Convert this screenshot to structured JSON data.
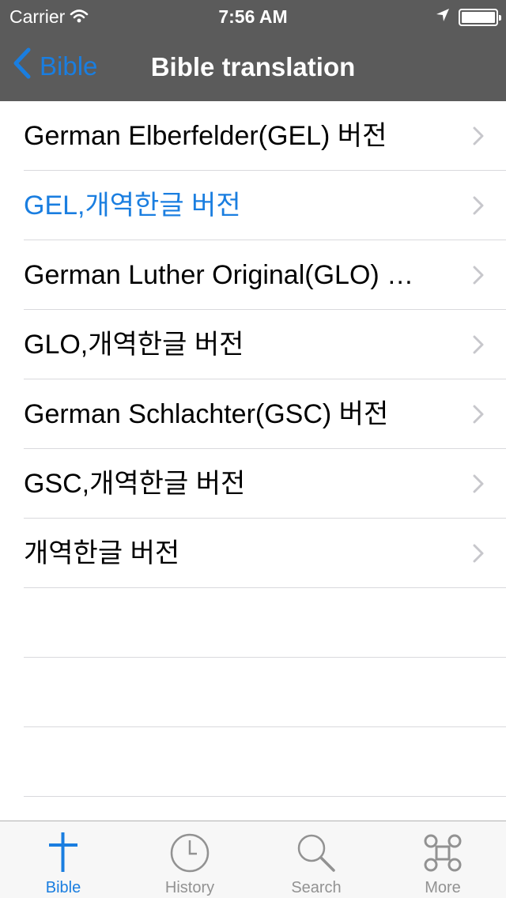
{
  "status_bar": {
    "carrier": "Carrier",
    "time": "7:56 AM"
  },
  "nav": {
    "back_label": "Bible",
    "title": "Bible translation"
  },
  "colors": {
    "accent": "#1a7ee0",
    "nav_background": "#5b5b5b"
  },
  "translations": [
    {
      "label": "German Elberfelder(GEL) 버전",
      "selected": false
    },
    {
      "label": "GEL,개역한글 버전",
      "selected": true
    },
    {
      "label": "German Luther Original(GLO) 버전",
      "selected": false
    },
    {
      "label": "GLO,개역한글 버전",
      "selected": false
    },
    {
      "label": "German Schlachter(GSC) 버전",
      "selected": false
    },
    {
      "label": "GSC,개역한글 버전",
      "selected": false
    },
    {
      "label": "개역한글 버전",
      "selected": false
    }
  ],
  "tabs": [
    {
      "label": "Bible",
      "icon": "cross-icon",
      "active": true
    },
    {
      "label": "History",
      "icon": "clock-icon",
      "active": false
    },
    {
      "label": "Search",
      "icon": "magnifier-icon",
      "active": false
    },
    {
      "label": "More",
      "icon": "command-key-icon",
      "active": false
    }
  ]
}
